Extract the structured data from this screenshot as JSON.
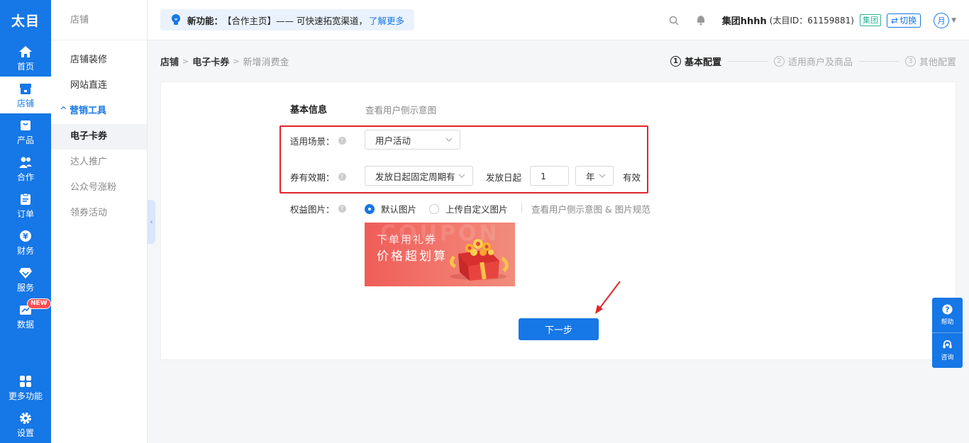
{
  "app": {
    "logo": "太目"
  },
  "rail": {
    "items": [
      {
        "label": "首页",
        "icon": "home-icon"
      },
      {
        "label": "店铺",
        "icon": "store-icon"
      },
      {
        "label": "产品",
        "icon": "bag-icon"
      },
      {
        "label": "合作",
        "icon": "users-icon"
      },
      {
        "label": "订单",
        "icon": "clipboard-icon"
      },
      {
        "label": "财务",
        "icon": "yen-icon"
      },
      {
        "label": "服务",
        "icon": "diamond-icon"
      },
      {
        "label": "数据",
        "icon": "chart-icon",
        "badge": "NEW"
      }
    ],
    "bottom": [
      {
        "label": "更多功能",
        "icon": "grid-icon"
      },
      {
        "label": "设置",
        "icon": "gear-icon"
      }
    ]
  },
  "subnav": {
    "title": "店铺",
    "items": [
      {
        "label": "店铺装修"
      },
      {
        "label": "网站直连"
      },
      {
        "label": "营销工具"
      },
      {
        "label": "电子卡券"
      },
      {
        "label": "达人推广"
      },
      {
        "label": "公众号涨粉"
      },
      {
        "label": "领券活动"
      }
    ]
  },
  "header": {
    "notice": {
      "prefix": "新功能：",
      "body": "【合作主页】—— 可快速拓宽渠道，",
      "link": "了解更多"
    },
    "account_name": "集团hhhh",
    "account_id": "(太目ID：61159881)",
    "group_tag": "集团",
    "switch_label": "切换",
    "avatar_text": "月"
  },
  "breadcrumb": [
    "店铺",
    "电子卡券",
    "新增消费金"
  ],
  "steps": [
    {
      "num": "1",
      "label": "基本配置"
    },
    {
      "num": "2",
      "label": "适用商户及商品"
    },
    {
      "num": "3",
      "label": "其他配置"
    }
  ],
  "form": {
    "section_title": "基本信息",
    "section_link": "查看用户侧示意图",
    "scene_label": "适用场景：",
    "scene_value": "用户活动",
    "validity_label": "券有效期：",
    "validity_mode": "发放日起固定周期有效",
    "validity_prefix": "发放日起",
    "validity_amount": "1",
    "validity_unit": "年",
    "validity_suffix": "有效",
    "image_label": "权益图片：",
    "image_default": "默认图片",
    "image_custom": "上传自定义图片",
    "image_link": "查看用户侧示意图 & 图片规范",
    "coupon_watermark": "COUPON",
    "coupon_line1": "下单用礼券",
    "coupon_line2": "价格超划算",
    "next_button": "下一步"
  },
  "float_panel": {
    "help": "帮助",
    "consult": "咨询"
  },
  "colors": {
    "primary": "#1677e6",
    "annotation": "#e0262b"
  }
}
